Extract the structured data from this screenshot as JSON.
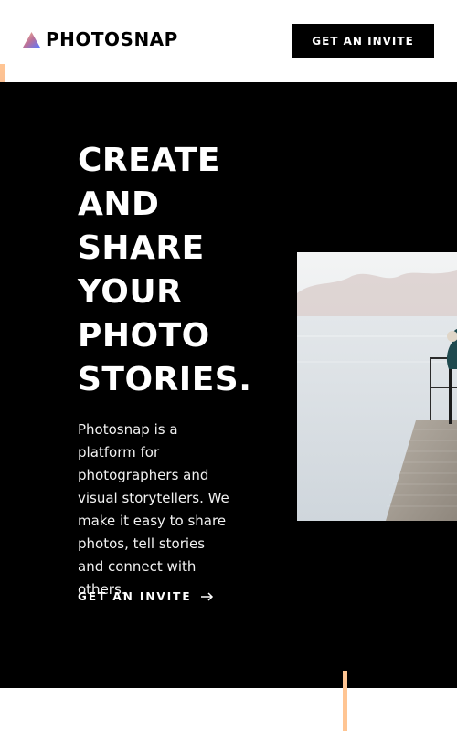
{
  "header": {
    "logo_text": "PHOTOSNAP",
    "cta_label": "GET AN INVITE"
  },
  "hero": {
    "title": "CREATE\nAND\nSHARE\nYOUR\nPHOTO\nSTORIES.",
    "description": "Photosnap is a platform for photographers and visual storytellers. We make it easy to share photos, tell stories and connect with others.",
    "link_label": "GET AN INVITE"
  },
  "colors": {
    "black": "#000000",
    "white": "#ffffff",
    "accent_orange": "#FFC593",
    "accent_pink": "#BC7198",
    "accent_blue": "#5A77FF"
  },
  "icons": {
    "logo": "triangle-gradient-icon",
    "link": "arrow-right-icon"
  }
}
